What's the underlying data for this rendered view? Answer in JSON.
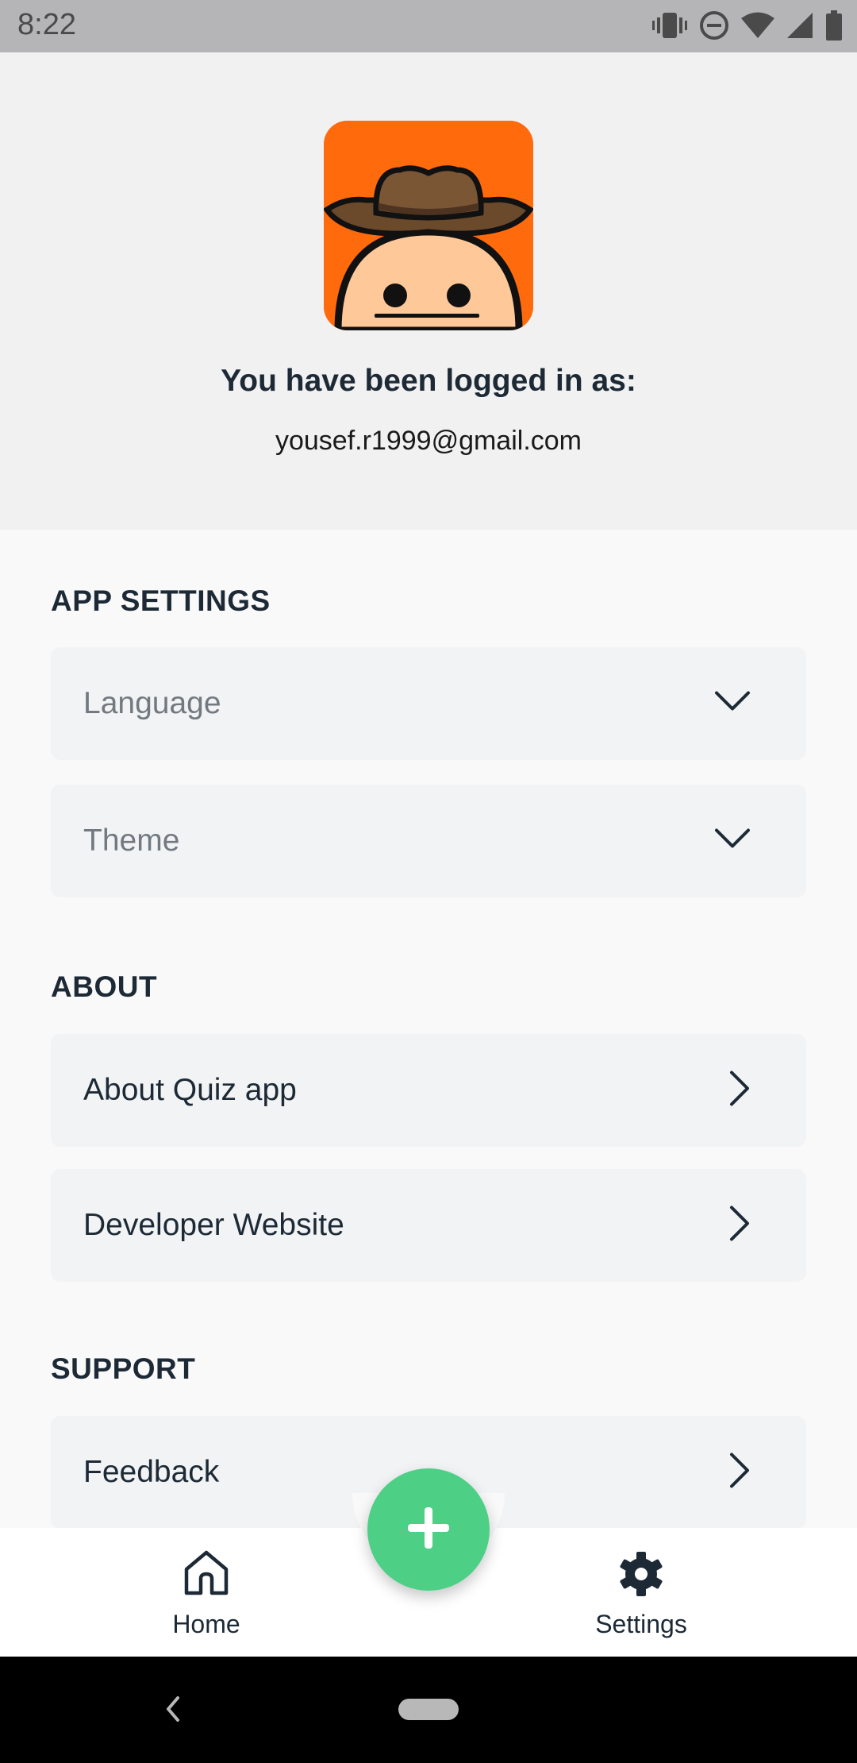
{
  "status_bar": {
    "time": "8:22"
  },
  "profile": {
    "heading": "You have been logged in as:",
    "email": "yousef.r1999@gmail.com"
  },
  "sections": {
    "app_settings": {
      "title": "APP SETTINGS",
      "language_label": "Language",
      "theme_label": "Theme"
    },
    "about": {
      "title": "ABOUT",
      "about_app_label": "About Quiz app",
      "developer_website_label": "Developer Website"
    },
    "support": {
      "title": "SUPPORT",
      "feedback_label": "Feedback"
    }
  },
  "bottom_nav": {
    "home_label": "Home",
    "settings_label": "Settings"
  },
  "colors": {
    "accent": "#4dcf86",
    "avatar_background": "#ff6a0c",
    "text_dark": "#1d2a36"
  },
  "icons": {
    "dropdown": "chevron-down-icon",
    "navigate": "chevron-right-icon",
    "fab": "plus-icon",
    "home": "home-icon",
    "settings": "gear-icon"
  }
}
